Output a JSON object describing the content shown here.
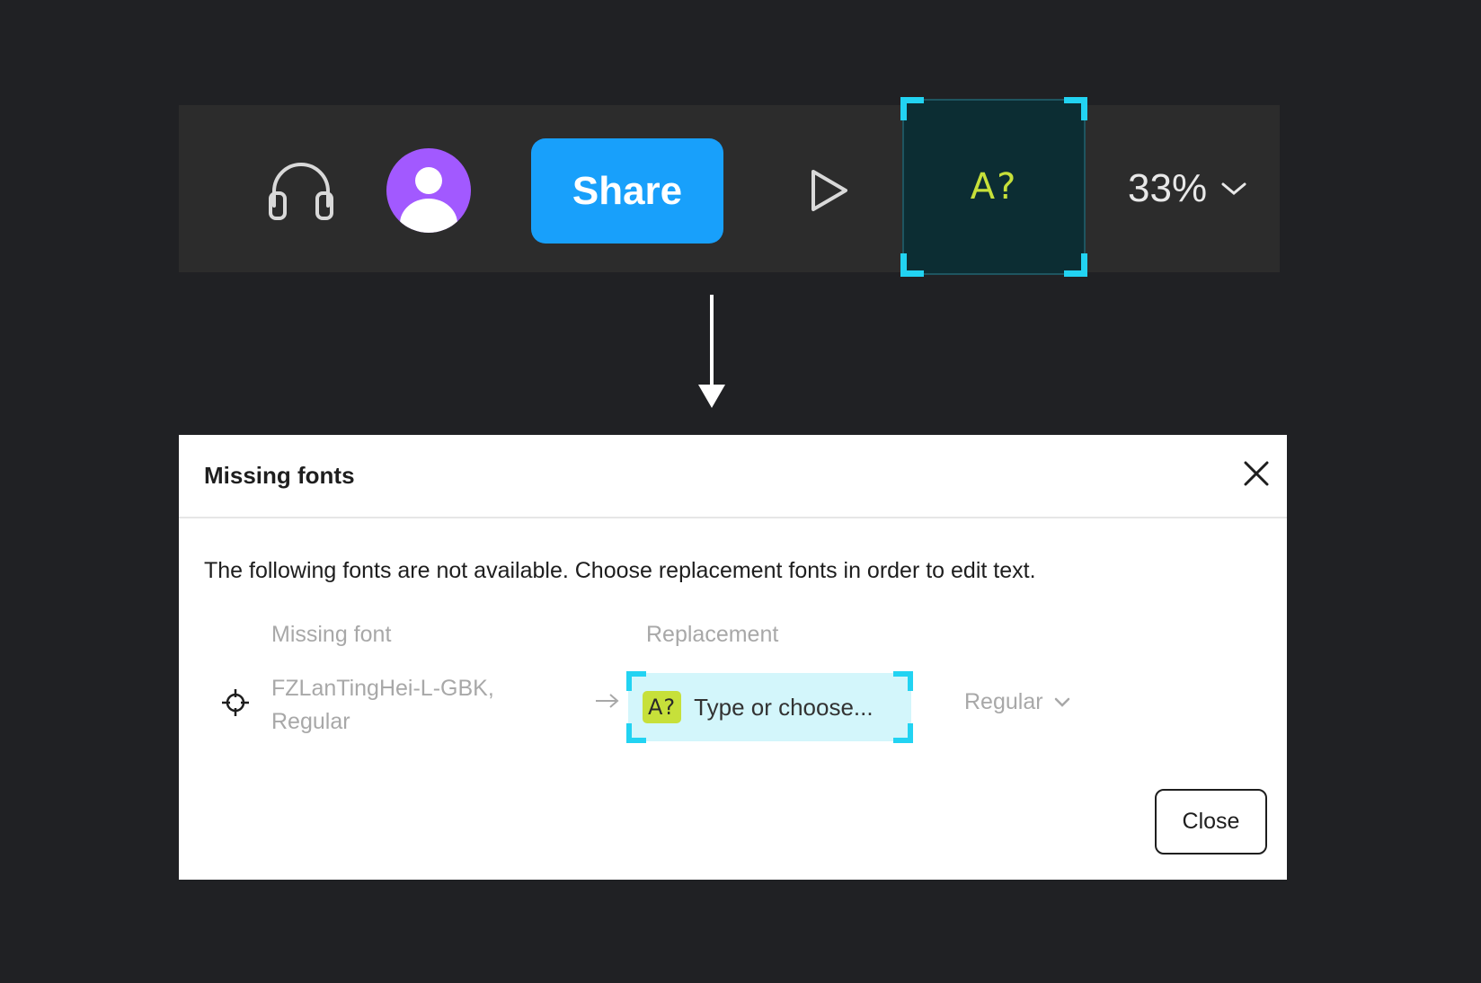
{
  "toolbar": {
    "share_label": "Share",
    "missing_font_indicator": "A?",
    "zoom_value": "33%",
    "colors": {
      "share_button": "#18a0fb",
      "avatar": "#a259ff",
      "indicator_bg": "#0c2d33",
      "indicator_text": "#c7e03a",
      "highlight": "#22d3f2"
    },
    "icons": [
      "headphones-icon",
      "user-icon",
      "play-icon",
      "chevron-down-icon"
    ]
  },
  "dialog": {
    "title": "Missing fonts",
    "description": "The following fonts are not available. Choose replacement fonts in order to edit text.",
    "columns": {
      "missing": "Missing font",
      "replacement": "Replacement"
    },
    "rows": [
      {
        "missing_font": "FZLanTingHei-L-GBK,",
        "missing_style": "Regular",
        "replacement_badge": "A?",
        "replacement_placeholder": "Type or choose...",
        "replacement_style": "Regular"
      }
    ],
    "close_label": "Close"
  }
}
